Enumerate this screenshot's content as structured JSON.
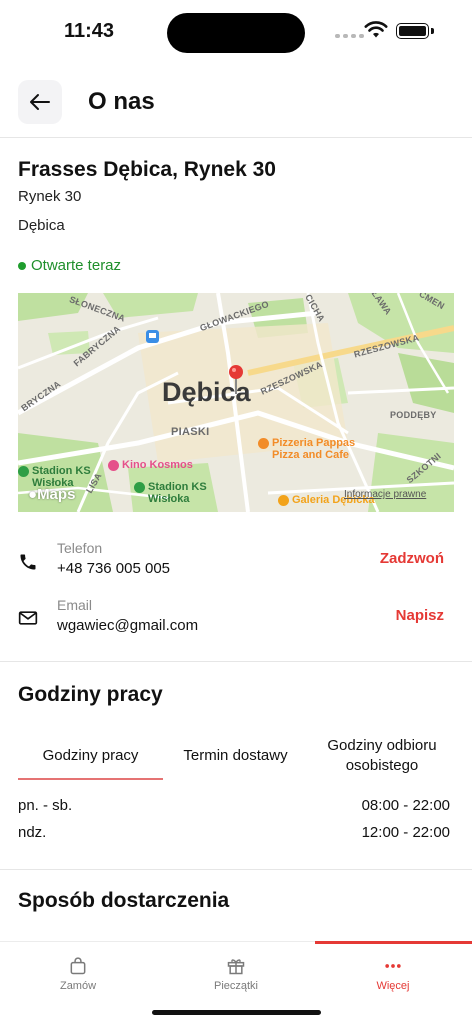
{
  "status_bar": {
    "time": "11:43"
  },
  "header": {
    "title": "O nas"
  },
  "restaurant": {
    "name": "Frasses Dębica, Rynek 30",
    "address_line1": "Rynek 30",
    "address_line2": "Dębica",
    "open_status": "Otwarte teraz"
  },
  "map": {
    "city": "Dębica",
    "streets": [
      "SŁONECZNA",
      "FABRYCZNA",
      "BRYCZNA",
      "GŁOWACKIEGO",
      "CICHA",
      "SŁAWA",
      "CMEN",
      "RZESZOWSKA",
      "RZESZOWSKA",
      "PODDĘBY",
      "SZKOTNI",
      "PIASKI",
      "LISA"
    ],
    "pois": [
      {
        "name": "Pizzeria Pappas Pizza and Cafe",
        "line1": "Pizzeria Pappas",
        "line2": "Pizza and Cafe",
        "color": "#f28c28"
      },
      {
        "name": "Kino Kosmos",
        "color": "#e5508a"
      },
      {
        "name": "Stadion KS Wisłoka",
        "line1": "Stadion KS",
        "line2": "Wisłoka",
        "color": "#2e9e45"
      },
      {
        "name": "Stadion KS Wisłoka",
        "line1": "Stadion KS",
        "line2": "Wisłoka",
        "color": "#2e9e45"
      },
      {
        "name": "Galeria Dębicka",
        "color": "#f2a31b"
      }
    ],
    "attribution": "Maps",
    "legal": "Informacje prawne"
  },
  "contacts": {
    "phone": {
      "label": "Telefon",
      "value": "+48 736 005 005",
      "action": "Zadzwoń"
    },
    "email": {
      "label": "Email",
      "value": "wgawiec@gmail.com",
      "action": "Napisz"
    }
  },
  "hours": {
    "title": "Godziny pracy",
    "tabs": [
      {
        "label": "Godziny pracy",
        "active": true
      },
      {
        "label": "Termin dostawy",
        "active": false
      },
      {
        "label": "Godziny odbioru osobistego",
        "active": false
      }
    ],
    "rows": [
      {
        "days": "pn. - sb.",
        "time": "08:00 - 22:00"
      },
      {
        "days": "ndz.",
        "time": "12:00 - 22:00"
      }
    ]
  },
  "delivery": {
    "title": "Sposób dostarczenia"
  },
  "bottom_nav": {
    "items": [
      {
        "label": "Zamów",
        "icon": "bag-icon",
        "active": false
      },
      {
        "label": "Pieczątki",
        "icon": "gift-icon",
        "active": false
      },
      {
        "label": "Więcej",
        "icon": "dots-icon",
        "active": true
      }
    ]
  },
  "colors": {
    "accent": "#e53935",
    "open_green": "#1f8f2b",
    "muted": "#8a8a8a"
  }
}
